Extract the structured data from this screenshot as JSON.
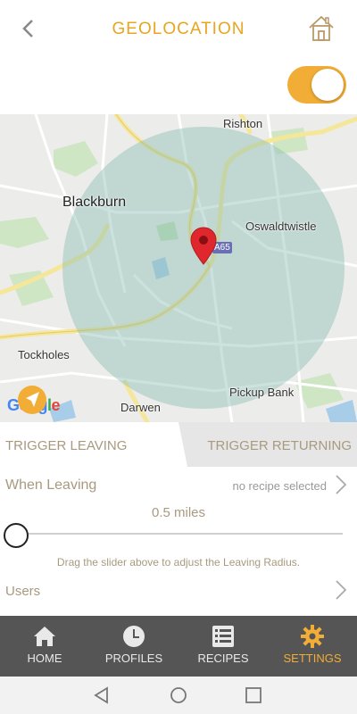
{
  "header": {
    "title": "GEOLOCATION",
    "back_icon": "chevron-left-icon",
    "home_icon": "house-icon"
  },
  "toggle": {
    "state": "on",
    "color": "#f2ad36"
  },
  "map": {
    "places": {
      "rishton": "Rishton",
      "blackburn": "Blackburn",
      "oswaldtwistle": "Oswaldtwistle",
      "tockholes": "Tockholes",
      "pickup_bank": "Pickup Bank",
      "darwen": "Darwen"
    },
    "road_shield": "A65",
    "google_logo": [
      "G",
      "o",
      "o",
      "g",
      "l",
      "e"
    ],
    "circle_color": "#9ec7c0",
    "pin_color": "#e0272d"
  },
  "tabs": {
    "leaving": "TRIGGER LEAVING",
    "returning": "TRIGGER RETURNING"
  },
  "when_leaving": {
    "label": "When Leaving",
    "status": "no recipe selected"
  },
  "slider": {
    "value_label": "0.5 miles",
    "hint": "Drag the slider above to adjust the Leaving Radius."
  },
  "users": {
    "label": "Users"
  },
  "navbar": {
    "items": [
      {
        "label": "HOME",
        "icon": "house-icon"
      },
      {
        "label": "PROFILES",
        "icon": "clock-icon"
      },
      {
        "label": "RECIPES",
        "icon": "list-icon"
      },
      {
        "label": "SETTINGS",
        "icon": "gear-icon"
      }
    ],
    "active_color": "#f2ad36"
  },
  "system_bar": {
    "icons": [
      "back-triangle-icon",
      "home-circle-icon",
      "recents-square-icon"
    ]
  }
}
